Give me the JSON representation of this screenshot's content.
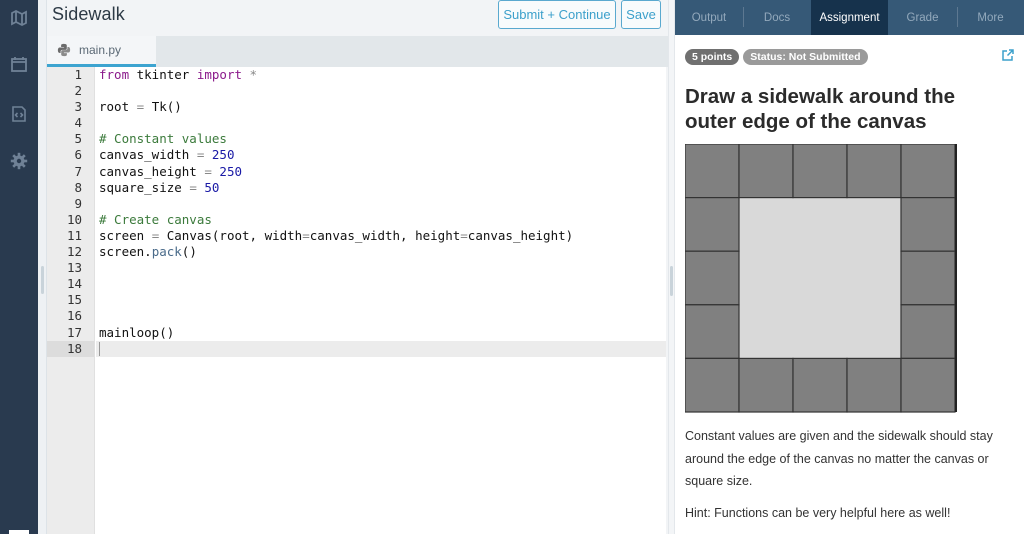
{
  "nav_rail": {
    "items": [
      {
        "icon": "map-icon"
      },
      {
        "icon": "calendar-icon"
      },
      {
        "icon": "code-file-icon"
      },
      {
        "icon": "gear-icon"
      }
    ]
  },
  "header": {
    "title": "Sidewalk",
    "submit_label": "Submit + Continue",
    "save_label": "Save"
  },
  "file_tabs": [
    {
      "icon": "python-icon",
      "label": "main.py",
      "active": true
    }
  ],
  "editor": {
    "line_numbers": [
      "1",
      "2",
      "3",
      "4",
      "5",
      "6",
      "7",
      "8",
      "9",
      "10",
      "11",
      "12",
      "13",
      "14",
      "15",
      "16",
      "17",
      "18"
    ],
    "lines": [
      "from tkinter import *",
      "",
      "root = Tk()",
      "",
      "# Constant values",
      "canvas_width = 250",
      "canvas_height = 250",
      "square_size = 50",
      "",
      "# Create canvas",
      "screen = Canvas(root, width=canvas_width, height=canvas_height)",
      "screen.pack()",
      "",
      "",
      "",
      "",
      "mainloop()",
      ""
    ],
    "active_line": 18
  },
  "right_panel": {
    "tabs": [
      {
        "label": "Output",
        "active": false
      },
      {
        "label": "Docs",
        "active": false
      },
      {
        "label": "Assignment",
        "active": true
      },
      {
        "label": "Grade",
        "active": false
      },
      {
        "label": "More",
        "active": false
      }
    ],
    "points_badge": "5 points",
    "status_badge": "Status: Not Submitted",
    "title": "Draw a sidewalk around the outer edge of the canvas",
    "example_image": {
      "description": "5x5 grid of dark gray squares forming a border around a light gray center",
      "grid": 5,
      "tile_color": "#808080",
      "center_color": "#d9d9d9",
      "line_color": "#333333"
    },
    "description": "Constant values are given and the sidewalk should stay around the edge of the canvas no matter the canvas or square size.",
    "hint": "Hint: Functions can be very helpful here as well!"
  },
  "colors": {
    "rail_bg": "#293a4f",
    "accent": "#3da4d0",
    "tabs_bg": "#365977",
    "tab_active_bg": "#16324c"
  }
}
